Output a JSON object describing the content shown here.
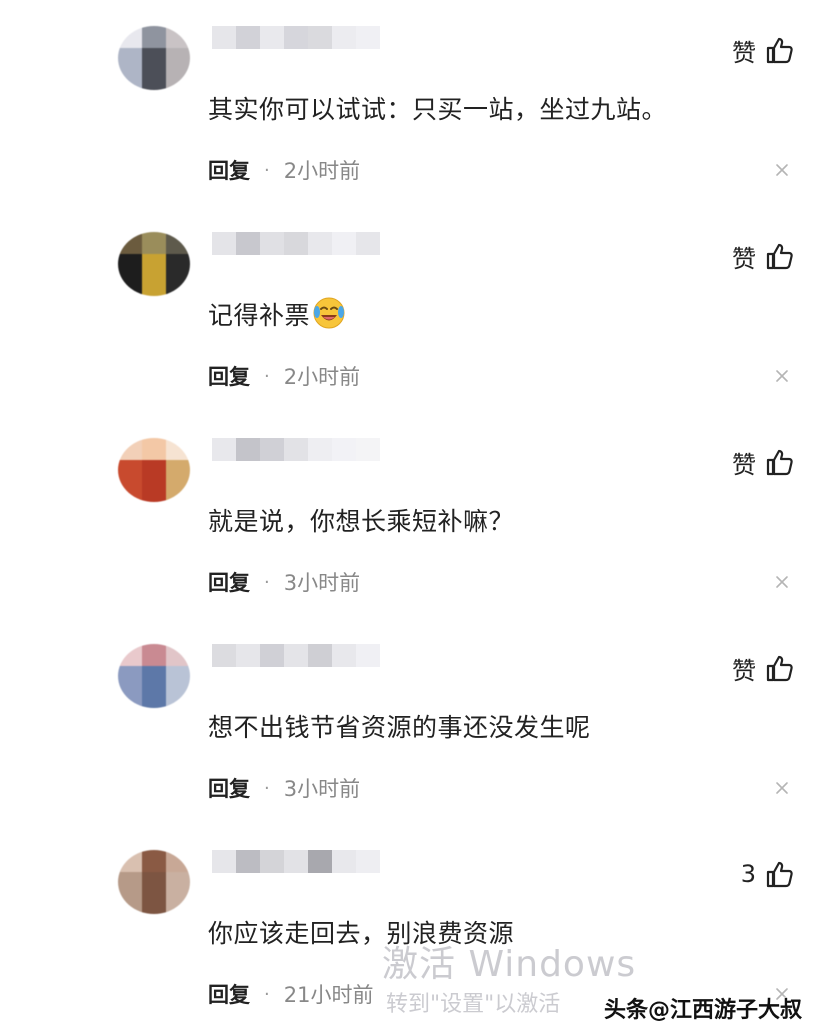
{
  "comments": [
    {
      "text": "其实你可以试试：只买一站，坐过九站。",
      "like_label": "赞",
      "reply_label": "回复",
      "separator": "·",
      "time": "2小时前",
      "avatar_colors": [
        "#e8e8ee",
        "#8f949f",
        "#c9c3c5",
        "#aeb5c6",
        "#4c4f58",
        "#b7b2b4"
      ],
      "name_colors": [
        "#e6e6ea",
        "#d2d2d8",
        "#e9e9ed",
        "#d6d6dc",
        "#dadade",
        "#ececf0",
        "#f0f0f4"
      ]
    },
    {
      "text": "记得补票",
      "emoji": "crying-laughing-emoji",
      "like_label": "赞",
      "reply_label": "回复",
      "separator": "·",
      "time": "2小时前",
      "avatar_colors": [
        "#6b5b3e",
        "#9a8d5b",
        "#5e5a4c",
        "#1d1d1d",
        "#c8a232",
        "#2a2a2a"
      ],
      "name_colors": [
        "#e4e4e8",
        "#c8c8ce",
        "#e0e0e4",
        "#d8d8dc",
        "#e8e8ec",
        "#f0f0f4",
        "#e6e6ea"
      ]
    },
    {
      "text": "就是说，你想长乘短补嘛？",
      "like_label": "赞",
      "reply_label": "回复",
      "separator": "·",
      "time": "3小时前",
      "avatar_colors": [
        "#f2d0b8",
        "#f3c8a6",
        "#f6e3d2",
        "#c84a2e",
        "#b93a25",
        "#d4aa6c"
      ],
      "name_colors": [
        "#e8e8ec",
        "#c4c4ca",
        "#d0d0d6",
        "#e2e2e6",
        "#eeeeF2",
        "#f2f2f6",
        "#f4f4f6"
      ]
    },
    {
      "text": "想不出钱节省资源的事还没发生呢",
      "like_label": "赞",
      "reply_label": "回复",
      "separator": "·",
      "time": "3小时前",
      "avatar_colors": [
        "#e9c9cc",
        "#c98a92",
        "#e1c5c8",
        "#8b9ac0",
        "#5d78a8",
        "#b9c3d6"
      ],
      "name_colors": [
        "#dcdce0",
        "#e6e6ea",
        "#d0d0d6",
        "#e4e4e8",
        "#cfcfd4",
        "#e8e8ec",
        "#f0f0f4"
      ]
    },
    {
      "text": "你应该走回去，别浪费资源",
      "like_label": "3",
      "reply_label": "回复",
      "separator": "·",
      "time": "21小时前",
      "avatar_colors": [
        "#d9c0b0",
        "#8a5a44",
        "#c8a896",
        "#b69a88",
        "#7d5542",
        "#c9b0a1"
      ],
      "name_colors": [
        "#e6e6ea",
        "#bcbcc2",
        "#d4d4d8",
        "#e2e2e6",
        "#a8a8ae",
        "#e8e8ec",
        "#eeeef2"
      ]
    }
  ],
  "watermark": {
    "line1": "激活 Windows",
    "line2": "转到\"设置\"以激活"
  },
  "credit": "头条@江西游子大叔"
}
